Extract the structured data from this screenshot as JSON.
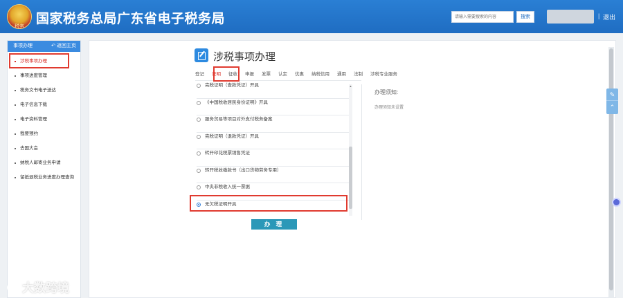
{
  "header": {
    "title": "国家税务总局广东省电子税务局",
    "search_placeholder": "请输入需要搜索的内容",
    "search_button": "搜索",
    "logout": "退出",
    "separator": "|",
    "colors": {
      "bar": "#1f6dc2"
    }
  },
  "sidebar": {
    "heading": "事项办理",
    "back_home": "返回主页",
    "items": [
      {
        "label": "涉税事项办理",
        "active": true
      },
      {
        "label": "事项进度管理"
      },
      {
        "label": "税务文书电子送达"
      },
      {
        "label": "电子信息下载"
      },
      {
        "label": "电子资料管理"
      },
      {
        "label": "我要预约"
      },
      {
        "label": "去国大会"
      },
      {
        "label": "纳税人邮寄业务申请"
      },
      {
        "label": "留抵退税业务进度办理查询"
      }
    ]
  },
  "main": {
    "title": "涉税事项办理",
    "tabs": [
      "登记",
      "证明",
      "征收",
      "申报",
      "发票",
      "认定",
      "优惠",
      "纳税信用",
      "通用",
      "法制",
      "涉税专业服务"
    ],
    "active_tab": "证明",
    "options": [
      {
        "label": "完税证明（查款凭证）开具"
      },
      {
        "label": "《中国税收居民身份证明》开具"
      },
      {
        "label": "服务贸易等项目对外支付税务备案"
      },
      {
        "label": "完税证明（退款凭证）开具"
      },
      {
        "label": "转开印花税票销售凭证"
      },
      {
        "label": "转开税收缴款书（出口货物劳务专用）"
      },
      {
        "label": "中央非税收入统一票据"
      },
      {
        "label": "无欠税证明开具",
        "selected": true
      }
    ],
    "submit_button": "办 理",
    "notice_title": "办理须知:",
    "notice_text": "办理须知未设置"
  },
  "float_tools": {
    "icons": [
      "feedback-icon",
      "back-to-top-icon"
    ]
  },
  "watermark": "大数跨境"
}
